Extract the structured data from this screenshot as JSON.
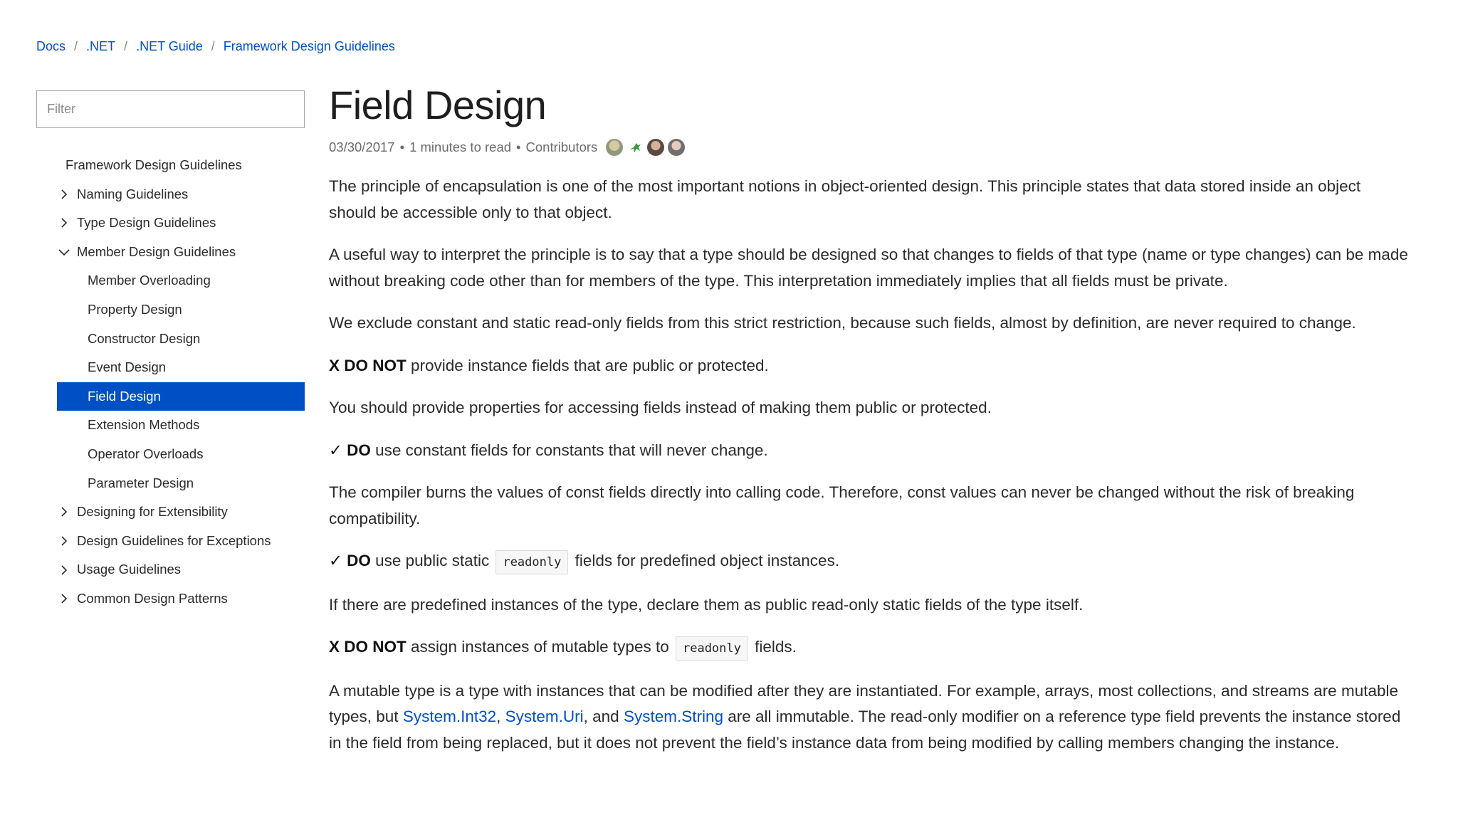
{
  "breadcrumb": {
    "items": [
      "Docs",
      ".NET",
      ".NET Guide",
      "Framework Design Guidelines"
    ],
    "separator": "/"
  },
  "sidebar": {
    "filter_placeholder": "Filter",
    "items": [
      {
        "label": "Framework Design Guidelines",
        "level": 0,
        "chevron": ""
      },
      {
        "label": "Naming Guidelines",
        "level": 1,
        "chevron": "chevron-right-icon"
      },
      {
        "label": "Type Design Guidelines",
        "level": 1,
        "chevron": "chevron-right-icon"
      },
      {
        "label": "Member Design Guidelines",
        "level": 1,
        "chevron": "chevron-down-icon"
      },
      {
        "label": "Member Overloading",
        "level": 2,
        "chevron": ""
      },
      {
        "label": "Property Design",
        "level": 2,
        "chevron": ""
      },
      {
        "label": "Constructor Design",
        "level": 2,
        "chevron": ""
      },
      {
        "label": "Event Design",
        "level": 2,
        "chevron": ""
      },
      {
        "label": "Field Design",
        "level": 2,
        "chevron": "",
        "active": true
      },
      {
        "label": "Extension Methods",
        "level": 2,
        "chevron": ""
      },
      {
        "label": "Operator Overloads",
        "level": 2,
        "chevron": ""
      },
      {
        "label": "Parameter Design",
        "level": 2,
        "chevron": ""
      },
      {
        "label": "Designing for Extensibility",
        "level": 1,
        "chevron": "chevron-right-icon"
      },
      {
        "label": "Design Guidelines for Exceptions",
        "level": 1,
        "chevron": "chevron-right-icon"
      },
      {
        "label": "Usage Guidelines",
        "level": 1,
        "chevron": "chevron-right-icon"
      },
      {
        "label": "Common Design Patterns",
        "level": 1,
        "chevron": "chevron-right-icon"
      }
    ]
  },
  "article": {
    "title": "Field Design",
    "date": "03/30/2017",
    "read_time": "1 minutes to read",
    "contributors_label": "Contributors",
    "bullet": "•",
    "contributor_avatars": [
      "avatar-1",
      "avatar-2",
      "avatar-3",
      "avatar-4"
    ],
    "p1": "The principle of encapsulation is one of the most important notions in object-oriented design. This principle states that data stored inside an object should be accessible only to that object.",
    "p2": "A useful way to interpret the principle is to say that a type should be designed so that changes to fields of that type (name or type changes) can be made without breaking code other than for members of the type. This interpretation immediately implies that all fields must be private.",
    "p3": "We exclude constant and static read-only fields from this strict restriction, because such fields, almost by definition, are never required to change.",
    "g1_marker": "X DO NOT",
    "g1_text": " provide instance fields that are public or protected.",
    "p4": "You should provide properties for accessing fields instead of making them public or protected.",
    "g2_marker": "✓ DO",
    "g2_text": " use constant fields for constants that will never change.",
    "p5": "The compiler burns the values of const fields directly into calling code. Therefore, const values can never be changed without the risk of breaking compatibility.",
    "g3_marker": "✓ DO",
    "g3_text_before": " use public static ",
    "g3_code": "readonly",
    "g3_text_after": " fields for predefined object instances.",
    "p6": "If there are predefined instances of the type, declare them as public read-only static fields of the type itself.",
    "g4_marker": "X DO NOT",
    "g4_text_before": " assign instances of mutable types to ",
    "g4_code": "readonly",
    "g4_text_after": " fields.",
    "p7_text_1": "A mutable type is a type with instances that can be modified after they are instantiated. For example, arrays, most collections, and streams are mutable types, but ",
    "p7_link_1": "System.Int32",
    "p7_comma": ", ",
    "p7_link_2": "System.Uri",
    "p7_and": ", and ",
    "p7_link_3": "System.String",
    "p7_text_2": " are all immutable. The read-only modifier on a reference type field prevents the instance stored in the field from being replaced, but it does not prevent the field’s instance data from being modified by calling members changing the instance."
  },
  "colors": {
    "accent": "#0050c5",
    "text": "#2b2b2b",
    "muted": "#6b6b6b"
  }
}
